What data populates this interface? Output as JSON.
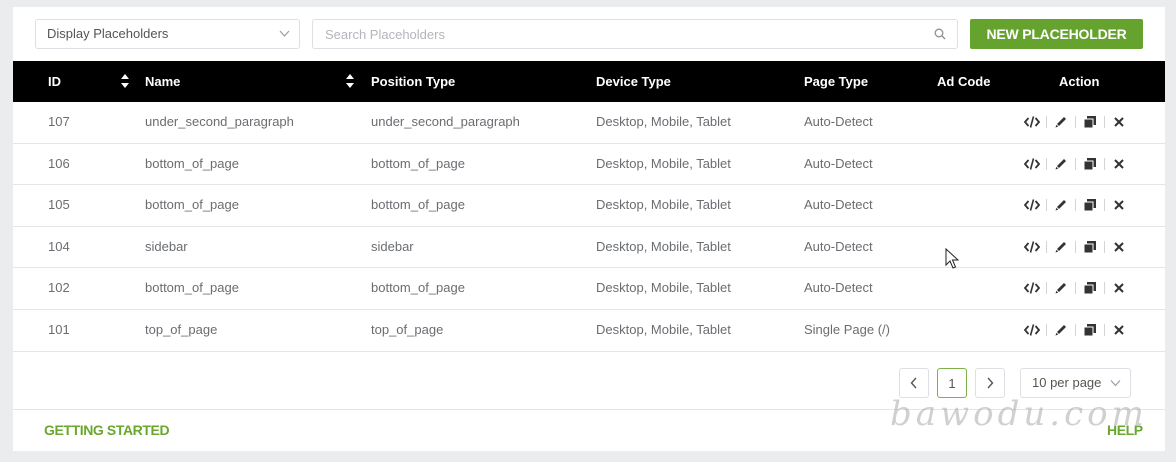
{
  "toolbar": {
    "filter_value": "Display Placeholders",
    "search_placeholder": "Search Placeholders",
    "new_button": "NEW PLACEHOLDER",
    "accent": "#66a32e"
  },
  "table": {
    "columns": {
      "id": "ID",
      "name": "Name",
      "position": "Position Type",
      "device": "Device Type",
      "page": "Page Type",
      "ad": "Ad Code",
      "action": "Action"
    },
    "rows": [
      {
        "id": "107",
        "name": "under_second_paragraph",
        "position": "under_second_paragraph",
        "device": "Desktop, Mobile, Tablet",
        "page": "Auto-Detect",
        "ad": ""
      },
      {
        "id": "106",
        "name": "bottom_of_page",
        "position": "bottom_of_page",
        "device": "Desktop, Mobile, Tablet",
        "page": "Auto-Detect",
        "ad": ""
      },
      {
        "id": "105",
        "name": "bottom_of_page",
        "position": "bottom_of_page",
        "device": "Desktop, Mobile, Tablet",
        "page": "Auto-Detect",
        "ad": ""
      },
      {
        "id": "104",
        "name": "sidebar",
        "position": "sidebar",
        "device": "Desktop, Mobile, Tablet",
        "page": "Auto-Detect",
        "ad": ""
      },
      {
        "id": "102",
        "name": "bottom_of_page",
        "position": "bottom_of_page",
        "device": "Desktop, Mobile, Tablet",
        "page": "Auto-Detect",
        "ad": ""
      },
      {
        "id": "101",
        "name": "top_of_page",
        "position": "top_of_page",
        "device": "Desktop, Mobile, Tablet",
        "page": "Single Page (/)",
        "ad": ""
      }
    ],
    "row_actions": [
      "code-icon",
      "pencil-icon",
      "copy-icon",
      "close-icon"
    ]
  },
  "pagination": {
    "prev": "‹",
    "current_page": "1",
    "next": "›",
    "per_page": "10 per page"
  },
  "footer": {
    "left_link": "GETTING STARTED",
    "right_link": "HELP"
  },
  "watermark": "bawodu.com"
}
